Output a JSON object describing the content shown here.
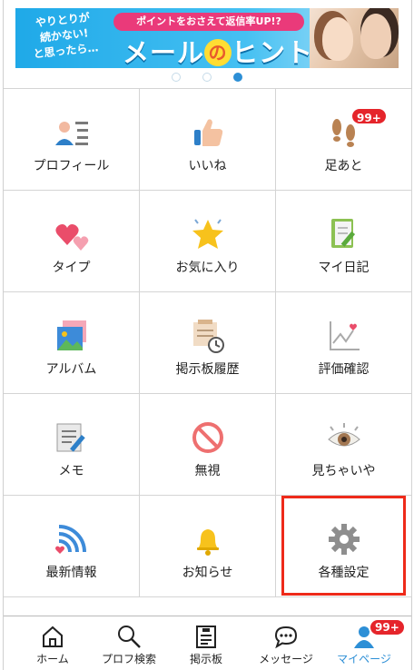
{
  "banner": {
    "left_lines": [
      "やりとりが",
      "続かない!",
      "と思ったら…"
    ],
    "pill_text": "ポイントをおさえて返信率UP!?",
    "title_pre": "メール",
    "title_no": "の",
    "title_post": "ヒント"
  },
  "carousel": {
    "count": 3,
    "active_index": 2
  },
  "menu": [
    {
      "label": "プロフィール",
      "icon": "profile-icon"
    },
    {
      "label": "いいね",
      "icon": "thumbs-up-icon"
    },
    {
      "label": "足あと",
      "icon": "footprints-icon",
      "badge": "99+"
    },
    {
      "label": "タイプ",
      "icon": "hearts-icon"
    },
    {
      "label": "お気に入り",
      "icon": "star-icon"
    },
    {
      "label": "マイ日記",
      "icon": "diary-icon"
    },
    {
      "label": "アルバム",
      "icon": "album-icon"
    },
    {
      "label": "掲示板履歴",
      "icon": "board-history-icon"
    },
    {
      "label": "評価確認",
      "icon": "rating-chart-icon"
    },
    {
      "label": "メモ",
      "icon": "memo-icon"
    },
    {
      "label": "無視",
      "icon": "block-icon"
    },
    {
      "label": "見ちゃいや",
      "icon": "eye-icon"
    },
    {
      "label": "最新情報",
      "icon": "news-feed-icon"
    },
    {
      "label": "お知らせ",
      "icon": "bell-icon"
    },
    {
      "label": "各種設定",
      "icon": "gear-icon"
    }
  ],
  "tabs": [
    {
      "label": "ホーム",
      "icon": "home-icon"
    },
    {
      "label": "プロフ検索",
      "icon": "search-icon"
    },
    {
      "label": "掲示板",
      "icon": "board-icon"
    },
    {
      "label": "メッセージ",
      "icon": "message-icon"
    },
    {
      "label": "マイページ",
      "icon": "mypage-icon",
      "badge": "99+",
      "active": true
    }
  ],
  "colors": {
    "accent": "#2d8fd6",
    "badge": "#e5252b",
    "highlight": "#ee2a1a"
  }
}
